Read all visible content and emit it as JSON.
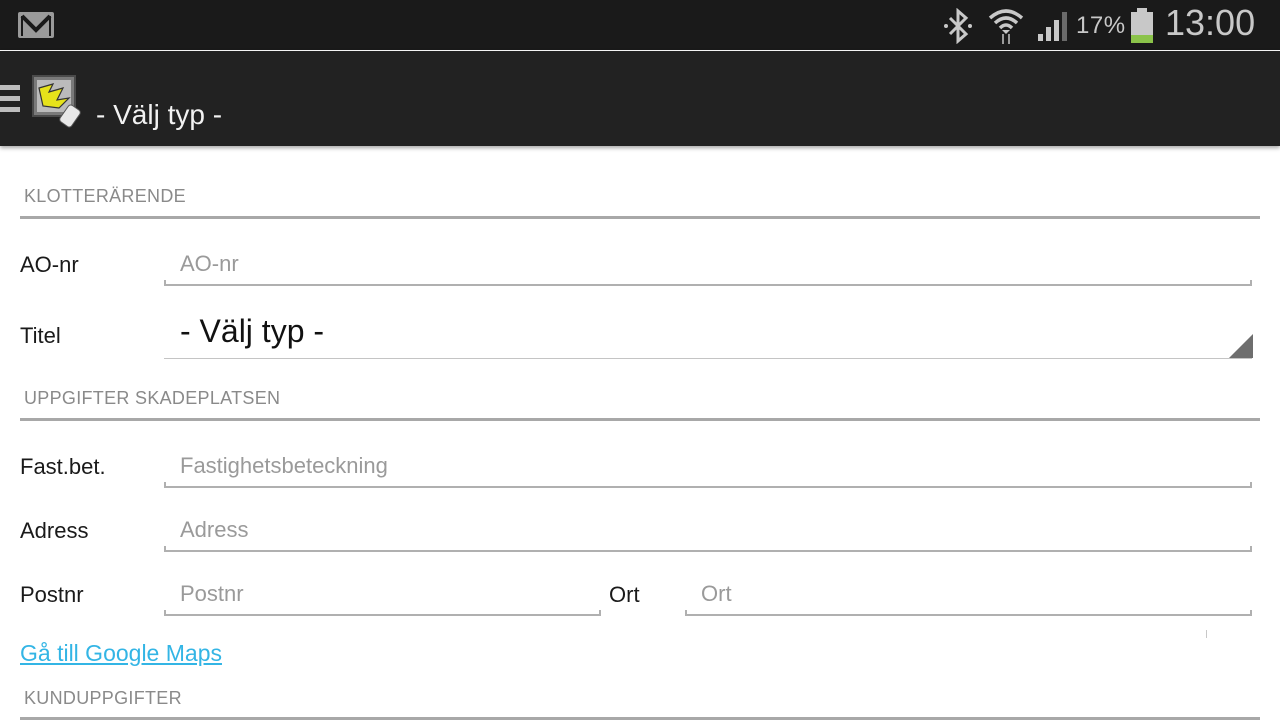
{
  "status_bar": {
    "notification_icon": "gmail-icon",
    "icons": [
      "bluetooth-icon",
      "wifi-icon",
      "signal-icon",
      "battery-icon"
    ],
    "battery_percent": "17%",
    "clock": "13:00",
    "battery_color": "#8bc34a"
  },
  "action_bar": {
    "menu_icon": "menu-icon",
    "logo_icon": "app-logo-icon",
    "title": "- Välj typ -"
  },
  "sections": {
    "klotterarende": {
      "header": "KLOTTERÄRENDE",
      "ao_nr": {
        "label": "AO-nr",
        "placeholder": "AO-nr",
        "value": ""
      },
      "titel": {
        "label": "Titel",
        "selected": "- Välj typ -"
      }
    },
    "uppgifter_skadeplatsen": {
      "header": "UPPGIFTER SKADEPLATSEN",
      "fast_bet": {
        "label": "Fast.bet.",
        "placeholder": "Fastighetsbeteckning",
        "value": ""
      },
      "adress": {
        "label": "Adress",
        "placeholder": "Adress",
        "value": ""
      },
      "postnr": {
        "label": "Postnr",
        "placeholder": "Postnr",
        "value": ""
      },
      "ort": {
        "label": "Ort",
        "placeholder": "Ort",
        "value": ""
      },
      "maps_link": "Gå till Google Maps"
    },
    "kunduppgifter": {
      "header": "KUNDUPPGIFTER"
    }
  },
  "colors": {
    "status_bar_bg": "#1a1a1a",
    "action_bar_bg": "#222222",
    "link": "#33b5e5",
    "section_header": "#8a8a8a"
  }
}
